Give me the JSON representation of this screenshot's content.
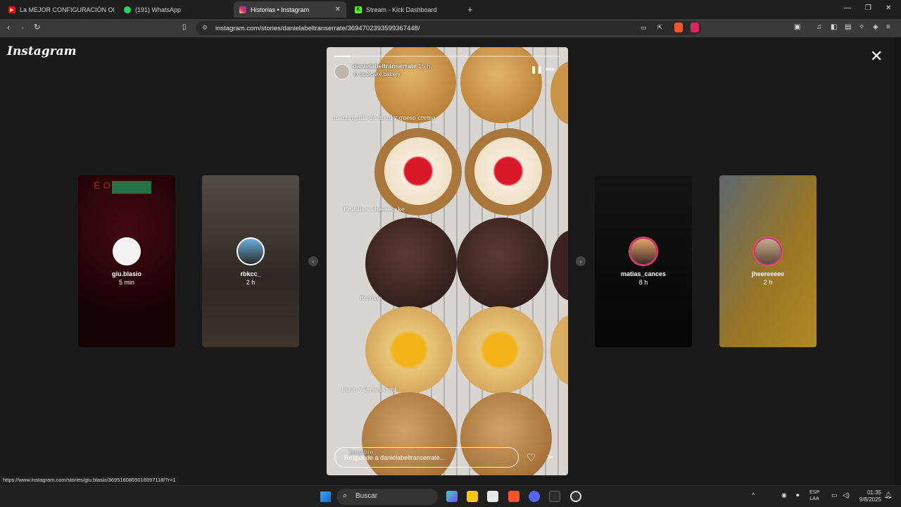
{
  "tabs": [
    {
      "title": "La MEJOR CONFIGURACIÓN OBS",
      "icon": "youtube-icon",
      "active": false
    },
    {
      "title": "(191) WhatsApp",
      "icon": "whatsapp-icon",
      "active": false
    },
    {
      "title": "Historias • Instagram",
      "icon": "instagram-icon",
      "active": true
    },
    {
      "title": "Stream - Kick Dashboard",
      "icon": "kick-icon",
      "active": false
    }
  ],
  "address_bar": {
    "url": "instagram.com/stories/danielabeltranserrate/3694702393599367448/"
  },
  "instagram": {
    "logo": "Instagram",
    "story": {
      "username": "danielabeltranserrate",
      "time": "15 h",
      "sub_account": "soulcake.bakery",
      "progress": 0.07,
      "captions": {
        "c1": "mantequilla de maní y queso crema",
        "c2": "Frutilla y cheesecake",
        "c3": "Brookie",
        "c4": "limón y lemon curd",
        "c5": "Jengibre"
      },
      "reply_placeholder": "Responde a danielabeltranserrate..."
    },
    "previews": [
      {
        "username": "giu.blasio",
        "time": "5 min"
      },
      {
        "username": "rbkcc_",
        "time": "2 h"
      },
      {
        "username": "matias_cances",
        "time": "8 h"
      },
      {
        "username": "jheereeeee",
        "time": "2 h"
      }
    ]
  },
  "status_url": "https://www.instagram.com/stories/giu.blasio/3695160855016997118/?r=1",
  "taskbar": {
    "search_label": "Buscar",
    "lang_top": "ESP",
    "lang_bottom": "LAA",
    "time": "01:35",
    "date": "9/8/2025"
  },
  "colors": {
    "story_ring": "#c13584",
    "brave": "#fb542b",
    "kick_green": "#53fc18"
  }
}
